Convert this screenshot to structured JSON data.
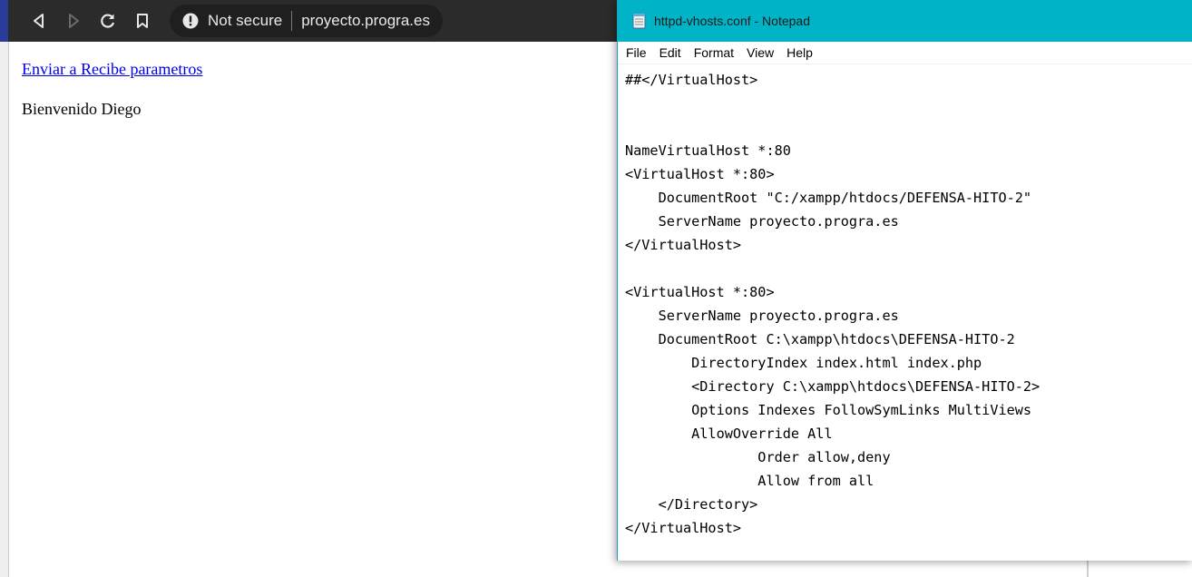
{
  "browser": {
    "security_label": "Not secure",
    "url": "proyecto.progra.es",
    "page": {
      "link_text": "Enviar a Recibe parametros",
      "greeting": "Bienvenido Diego"
    }
  },
  "notepad": {
    "title": "httpd-vhosts.conf - Notepad",
    "menu": [
      "File",
      "Edit",
      "Format",
      "View",
      "Help"
    ],
    "lines": [
      "##</VirtualHost>",
      "",
      "",
      "NameVirtualHost *:80",
      "<VirtualHost *:80>",
      "    DocumentRoot \"C:/xampp/htdocs/DEFENSA-HITO-2\"",
      "    ServerName proyecto.progra.es",
      "</VirtualHost>",
      "",
      "<VirtualHost *:80>",
      "    ServerName proyecto.progra.es",
      "    DocumentRoot C:\\xampp\\htdocs\\DEFENSA-HITO-2",
      "        DirectoryIndex index.html index.php",
      "        <Directory C:\\xampp\\htdocs\\DEFENSA-HITO-2>",
      "        Options Indexes FollowSymLinks MultiViews",
      "        AllowOverride All",
      "                Order allow,deny",
      "                Allow from all",
      "    </Directory>",
      "</VirtualHost>"
    ]
  },
  "icons": {
    "back": "back-icon",
    "forward": "forward-icon",
    "reload": "reload-icon",
    "bookmark": "bookmark-icon",
    "warning": "warning-icon",
    "notepad": "notepad-icon"
  },
  "colors": {
    "browser_toolbar": "#2b2b2b",
    "notepad_titlebar": "#00b3c7",
    "link": "#0000ee"
  }
}
